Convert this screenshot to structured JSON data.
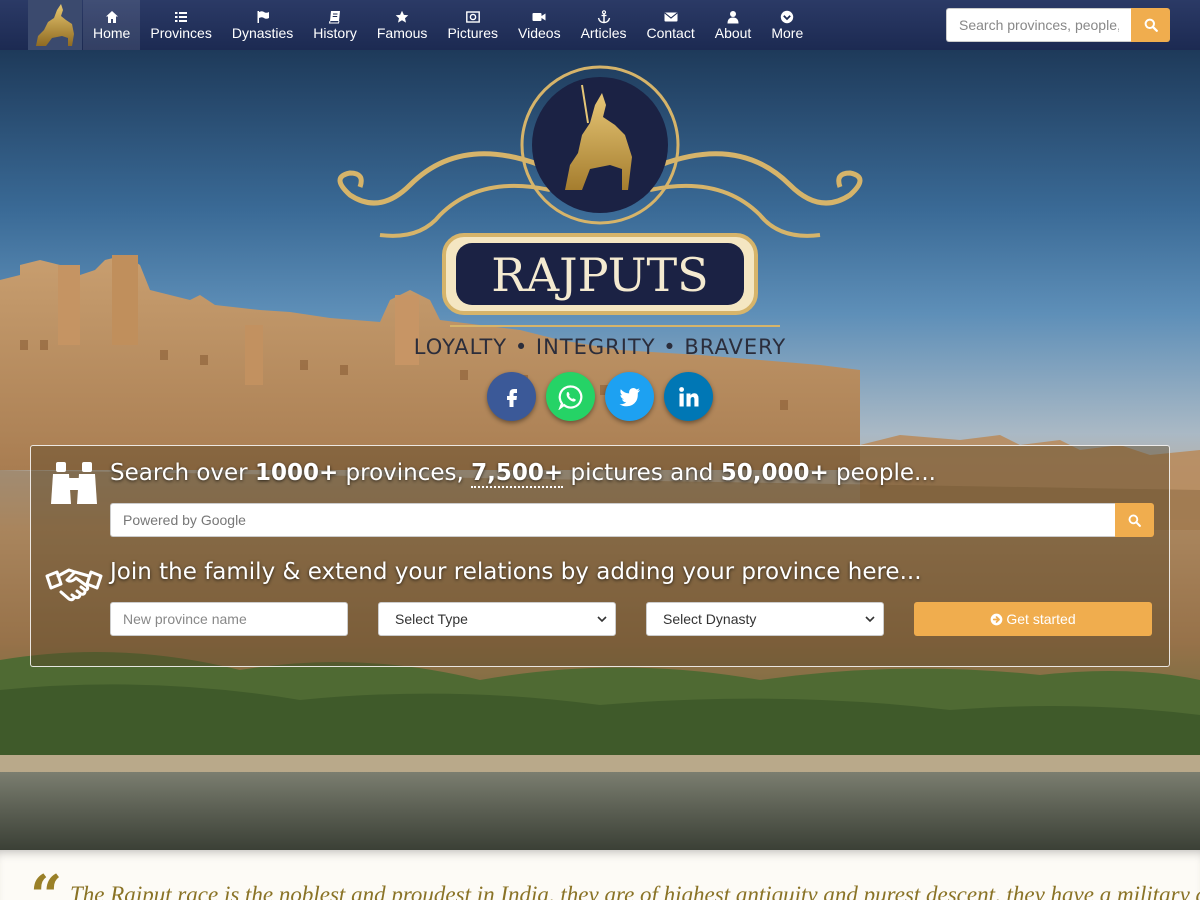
{
  "nav": {
    "items": [
      {
        "label": "Home",
        "icon": "home-icon"
      },
      {
        "label": "Provinces",
        "icon": "list-icon"
      },
      {
        "label": "Dynasties",
        "icon": "flag-icon"
      },
      {
        "label": "History",
        "icon": "book-icon"
      },
      {
        "label": "Famous",
        "icon": "star-icon"
      },
      {
        "label": "Pictures",
        "icon": "picture-icon"
      },
      {
        "label": "Videos",
        "icon": "video-camera-icon"
      },
      {
        "label": "Articles",
        "icon": "anchor-icon"
      },
      {
        "label": "Contact",
        "icon": "envelope-icon"
      },
      {
        "label": "About",
        "icon": "user-icon"
      },
      {
        "label": "More",
        "icon": "chevron-circle-down-icon"
      }
    ],
    "active_item": "Home",
    "search_placeholder": "Search provinces, people, ..."
  },
  "hero": {
    "logo_text": "RAJPUTS",
    "tagline": "LOYALTY • INTEGRITY • BRAVERY",
    "social": [
      {
        "name": "facebook",
        "color": "#3b5998"
      },
      {
        "name": "whatsapp",
        "color": "#25d366"
      },
      {
        "name": "twitter",
        "color": "#1da1f2"
      },
      {
        "name": "linkedin",
        "color": "#0077b5"
      }
    ]
  },
  "search_panel": {
    "headline_prefix": "Search over ",
    "provinces_count": "1000+",
    "provinces_text": " provinces, ",
    "pictures_count": "7,500+",
    "pictures_text": " pictures and ",
    "people_count": "50,000+",
    "people_text": " people...",
    "google_placeholder": "Powered by Google",
    "join_headline": "Join the family & extend your relations by adding your province here...",
    "province_placeholder": "New province name",
    "type_select": "Select Type",
    "dynasty_select": "Select Dynasty",
    "get_started_label": "Get started"
  },
  "quote": {
    "text": "The Rajput race is the noblest and proudest in India, they are of highest antiquity and purest descent, they have a military autocracy of"
  },
  "colors": {
    "nav_bg": "#1c2a52",
    "accent": "#f0ad4e",
    "logo_navy": "#1b2244",
    "logo_gold": "#c9a24a",
    "quote_gold": "#8a7326"
  }
}
